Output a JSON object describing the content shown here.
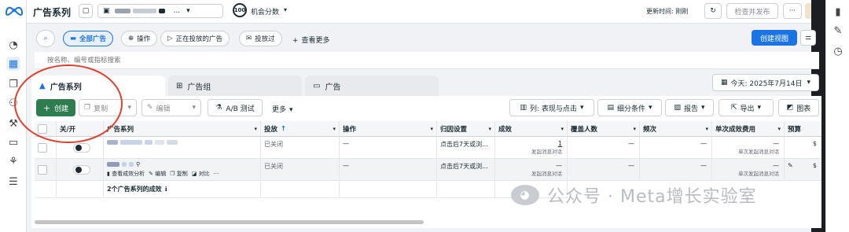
{
  "app": {
    "title": "广告系列"
  },
  "topbar": {
    "account_ellipsis": "...",
    "opportunity_score": "100",
    "opportunity_label": "机会分数",
    "update_time": "更新时间: 刚刚",
    "review_publish": "检查并发布",
    "more": "···"
  },
  "filters": {
    "all_ads": "全部广告",
    "actions": "操作",
    "active_ads": "正在投放的广告",
    "delivered": "投放过",
    "view_more": "查看更多",
    "create_view": "创建视图"
  },
  "search": {
    "placeholder": "按名称、编号或指标搜索"
  },
  "tabs": {
    "campaigns": "广告系列",
    "adsets": "广告组",
    "ads": "广告"
  },
  "date": {
    "label": "今天: 2025年7月14日"
  },
  "toolbar": {
    "create": "创建",
    "copy": "复制",
    "edit": "编辑",
    "ab_test": "A/B 测试",
    "more": "更多",
    "columns": "列: 表现与点击",
    "breakdown": "细分条件",
    "reports": "报告",
    "export": "导出",
    "charts": "图表"
  },
  "table": {
    "headers": [
      "关/开",
      "广告系列",
      "投放",
      "操作",
      "归因设置",
      "成效",
      "覆盖人数",
      "频次",
      "单次成效费用",
      "预算"
    ],
    "rows": [
      {
        "delivery": "已关闭",
        "action": "—",
        "attribution": "点击后7天或浏...",
        "results": "1",
        "results_sub": "发起消息对话",
        "reach": "—",
        "frequency": "—",
        "cost": "—",
        "cost_sub": "单次发起消息对话",
        "budget": "$"
      },
      {
        "delivery": "已关闭",
        "action": "—",
        "attribution": "点击后7天或浏...",
        "results": "—",
        "results_sub": "发起消息对话",
        "reach": "—",
        "frequency": "—",
        "cost": "—",
        "cost_sub": "单次发起消息对话",
        "budget": "$",
        "row_actions": {
          "view": "查看成效分析",
          "edit": "编辑",
          "copy": "复制",
          "compare": "对比",
          "more": "···"
        }
      }
    ],
    "summary": "2个广告系列的成效"
  },
  "watermark": {
    "text": "公众号 · Meta增长实验室"
  },
  "colors": {
    "primary": "#1b74e4",
    "create_green": "#2e7d4f",
    "annotation_red": "#e0402e"
  }
}
